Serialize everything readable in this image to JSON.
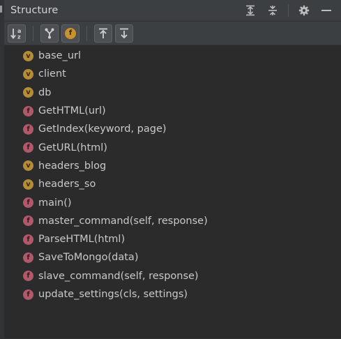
{
  "panel": {
    "title": "Structure"
  },
  "title_actions": [
    {
      "name": "expand-all-icon"
    },
    {
      "name": "collapse-all-icon"
    },
    {
      "name": "gear-icon"
    },
    {
      "name": "minimize-icon"
    }
  ],
  "toolbar": {
    "sort_alpha_icon": "sort-alphabetically-icon",
    "inherited_icon": "show-inherited-icon",
    "fields_icon": "show-fields-icon",
    "fields_glyph": "f",
    "expand_icon": "expand-icon",
    "collapse_icon": "collapse-icon"
  },
  "tree": {
    "items": [
      {
        "kind": "v",
        "label": "base_url"
      },
      {
        "kind": "v",
        "label": "client"
      },
      {
        "kind": "v",
        "label": "db"
      },
      {
        "kind": "f",
        "label": "GetHTML(url)"
      },
      {
        "kind": "f",
        "label": "GetIndex(keyword, page)"
      },
      {
        "kind": "f",
        "label": "GetURL(html)"
      },
      {
        "kind": "v",
        "label": "headers_blog"
      },
      {
        "kind": "v",
        "label": "headers_so"
      },
      {
        "kind": "f",
        "label": "main()"
      },
      {
        "kind": "f",
        "label": "master_command(self, response)"
      },
      {
        "kind": "f",
        "label": "ParseHTML(html)"
      },
      {
        "kind": "f",
        "label": "SaveToMongo(data)"
      },
      {
        "kind": "f",
        "label": "slave_command(self, response)"
      },
      {
        "kind": "f",
        "label": "update_settings(cls, settings)"
      }
    ]
  },
  "colors": {
    "background": "#2b2b2b",
    "header": "#3c3f41",
    "variable_badge": "#b58c38",
    "function_badge": "#b1596b",
    "text": "#c9c9c9"
  }
}
